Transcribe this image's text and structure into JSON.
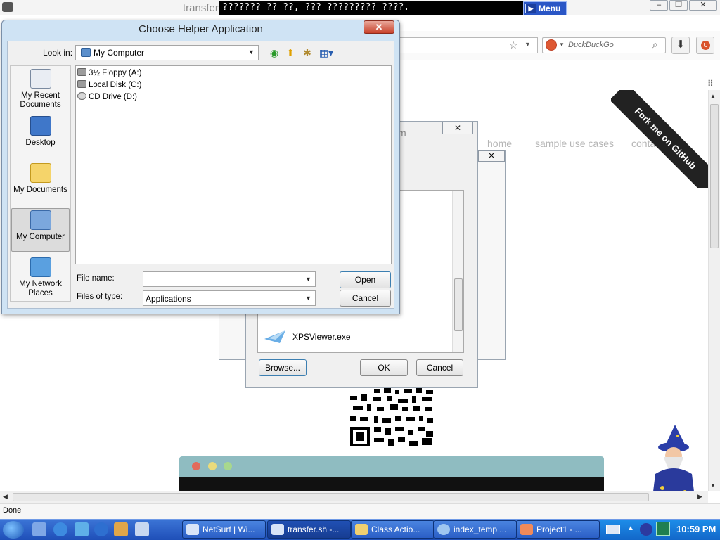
{
  "browser": {
    "title": "transfer",
    "banner_text": "??????? ?? ??, ??? ????????? ????.",
    "banner_menu": "Menu",
    "win_min": "–",
    "win_max": "❐",
    "win_close": "✕",
    "search_placeholder": "DuckDuckGo",
    "status": "Done"
  },
  "page": {
    "nav": [
      "home",
      "sample use cases",
      "contact"
    ],
    "ribbon": "Fork me on GitHub",
    "partial_title": "m"
  },
  "bg_dialog": {
    "list_item": "XPSViewer.exe",
    "browse_label": "Browse...",
    "ok_label": "OK",
    "cancel_label": "Cancel"
  },
  "dialog": {
    "title": "Choose Helper Application",
    "look_in_label": "Look in:",
    "look_in_value": "My Computer",
    "places": [
      "My Recent Documents",
      "Desktop",
      "My Documents",
      "My Computer",
      "My Network Places"
    ],
    "files": [
      "3½ Floppy (A:)",
      "Local Disk (C:)",
      "CD Drive (D:)"
    ],
    "file_name_label": "File name:",
    "file_name_value": "",
    "files_of_type_label": "Files of type:",
    "files_of_type_value": "Applications",
    "open_label": "Open",
    "cancel_label": "Cancel"
  },
  "taskbar": {
    "tasks": [
      "NetSurf | Wi...",
      "transfer.sh -...",
      "Class Actio...",
      "index_temp ...",
      "Project1 - ..."
    ],
    "clock": "10:59 PM"
  }
}
